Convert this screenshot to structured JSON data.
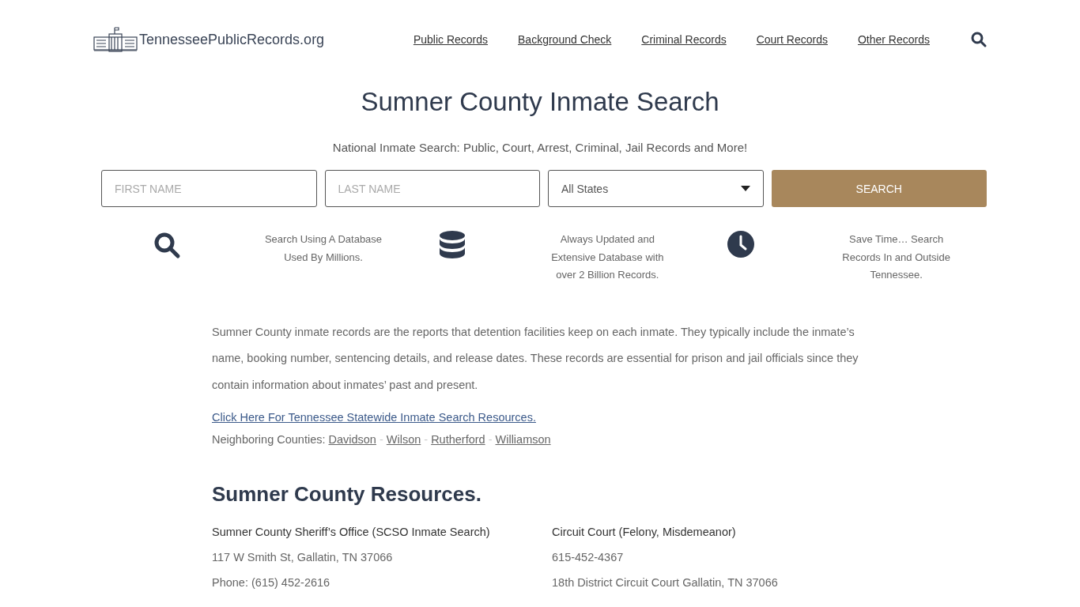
{
  "header": {
    "logo": "TennesseePublicRecords.org",
    "nav": [
      "Public Records",
      "Background Check",
      "Criminal Records",
      "Court Records",
      "Other Records"
    ]
  },
  "hero": {
    "title": "Sumner County Inmate Search",
    "subtitle": "National Inmate Search: Public, Court, Arrest, Criminal, Jail Records and More!"
  },
  "search_form": {
    "first_name": {
      "placeholder": "FIRST NAME"
    },
    "last_name": {
      "placeholder": "LAST NAME"
    },
    "state": {
      "value": "All States"
    },
    "button": "SEARCH"
  },
  "features": [
    {
      "kind": "search",
      "text": "Search Using A Database Used By Millions."
    },
    {
      "kind": "database",
      "text": "Always Updated and Extensive Database with over 2 Billion Records."
    },
    {
      "kind": "clock",
      "text": "Save Time… Search Records In and Outside Tennessee."
    }
  ],
  "intro": "Sumner County inmate records are the reports that detention facilities keep on each inmate. They typically include the inmate’s name, booking number, sentencing details, and release dates. These records are essential for prison and jail officials since they contain information about inmates’ past and present.",
  "statewide_link": "Click Here For Tennessee Statewide Inmate Search Resources.",
  "neighbors": {
    "label": "Neighboring Counties:",
    "separator": "-",
    "counties": [
      "Davidson",
      "Wilson",
      "Rutherford",
      "Williamson"
    ]
  },
  "resources": {
    "heading": "Sumner County Resources.",
    "columns": [
      {
        "title": "Sumner County Sheriff’s Office (SCSO Inmate Search)",
        "lines": [
          "117 W Smith St, Gallatin, TN 37066",
          "Phone: (615) 452-2616"
        ]
      },
      {
        "title": "Circuit Court (Felony, Misdemeanor)",
        "lines": [
          "615-452-4367",
          "18th District Circuit Court Gallatin, TN 37066"
        ]
      }
    ]
  }
}
